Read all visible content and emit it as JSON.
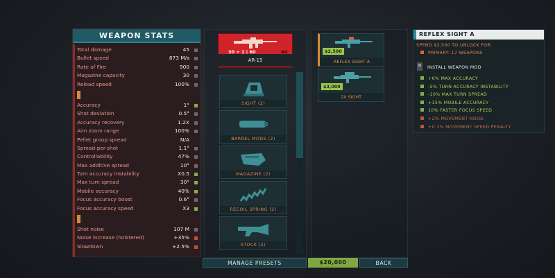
{
  "stats_panel": {
    "title": "WEAPON STATS",
    "groups": [
      [
        {
          "label": "Total damage",
          "value": "45",
          "indicator": "grey"
        },
        {
          "label": "Bullet speed",
          "value": "873 M/s",
          "indicator": "grey"
        },
        {
          "label": "Rate of Fire",
          "value": "900",
          "indicator": "grey"
        },
        {
          "label": "Magazine capacity",
          "value": "30",
          "indicator": "grey"
        },
        {
          "label": "Reload speed",
          "value": "100%",
          "indicator": "grey"
        }
      ],
      [
        {
          "label": "Accuracy",
          "value": "1°",
          "indicator": "green"
        },
        {
          "label": "Shot deviation",
          "value": "0.5°",
          "indicator": "grey"
        },
        {
          "label": "Accuracy recovery",
          "value": "1.2X",
          "indicator": "grey"
        },
        {
          "label": "Aim zoom range",
          "value": "100%",
          "indicator": "grey"
        },
        {
          "label": "Pellet group spread",
          "value": "N/A",
          "indicator": "none"
        },
        {
          "label": "Spread-per-shot",
          "value": "1.1°",
          "indicator": "grey"
        },
        {
          "label": "Controllability",
          "value": "47%",
          "indicator": "grey"
        },
        {
          "label": "Max additive spread",
          "value": "10°",
          "indicator": "grey"
        },
        {
          "label": "Turn accuracy instability",
          "value": "X0.5",
          "indicator": "green"
        },
        {
          "label": "Max turn spread",
          "value": "30°",
          "indicator": "green"
        },
        {
          "label": "Mobile accuracy",
          "value": "40%",
          "indicator": "green"
        },
        {
          "label": "Focus accuracy boost",
          "value": "0.6°",
          "indicator": "grey"
        },
        {
          "label": "Focus accuracy speed",
          "value": "X3",
          "indicator": "green"
        }
      ],
      [
        {
          "label": "Shot noise",
          "value": "107 M",
          "indicator": "grey"
        },
        {
          "label": "Noise increase (holstered)",
          "value": "+35%",
          "indicator": "red"
        },
        {
          "label": "Slowdown",
          "value": "+2.5%",
          "indicator": "red"
        }
      ]
    ]
  },
  "weapon": {
    "name": "AR-15",
    "ammo": "30 + 1 | 60",
    "ammo_right": "4d"
  },
  "mod_categories": [
    {
      "label": "SIGHT (2)",
      "icon": "sight-icon",
      "selected": true
    },
    {
      "label": "BARREL MODS (2)",
      "icon": "suppressor-icon",
      "selected": false
    },
    {
      "label": "MAGAZINE (2)",
      "icon": "magazine-icon",
      "selected": false
    },
    {
      "label": "RECOIL SPRING (2)",
      "icon": "spring-icon",
      "selected": false
    },
    {
      "label": "STOCK (2)",
      "icon": "stock-icon",
      "selected": false
    }
  ],
  "mod_options": [
    {
      "label": "REFLEX SIGHT A",
      "price": "$2,500",
      "selected": true
    },
    {
      "label": "2X SIGHT",
      "price": "$3,000",
      "selected": false
    }
  ],
  "info_panel": {
    "title": "REFLEX SIGHT A",
    "unlock_text": "SPEND $2,500 TO UNLOCK FOR:",
    "unlock_item": "PRIMARY: 17 WEAPONS",
    "install_text": "INSTALL WEAPON MOD",
    "effects": [
      {
        "text": "+6% MAX ACCURACY",
        "tone": "green"
      },
      {
        "text": "-5% TURN ACCURACY INSTABILITY",
        "tone": "green"
      },
      {
        "text": "-10% MAX TURN SPREAD",
        "tone": "green"
      },
      {
        "text": "+15% MOBILE ACCURACY",
        "tone": "green"
      },
      {
        "text": "10% FASTER FOCUS SPEED",
        "tone": "green"
      },
      {
        "text": "+2% MOVEMENT NOISE",
        "tone": "red"
      },
      {
        "text": "+0.3% MOVEMENT SPEED PENALTY",
        "tone": "red"
      }
    ]
  },
  "bottom_bar": {
    "presets_label": "MANAGE PRESETS",
    "cash": "$20,000",
    "back_label": "BACK"
  }
}
